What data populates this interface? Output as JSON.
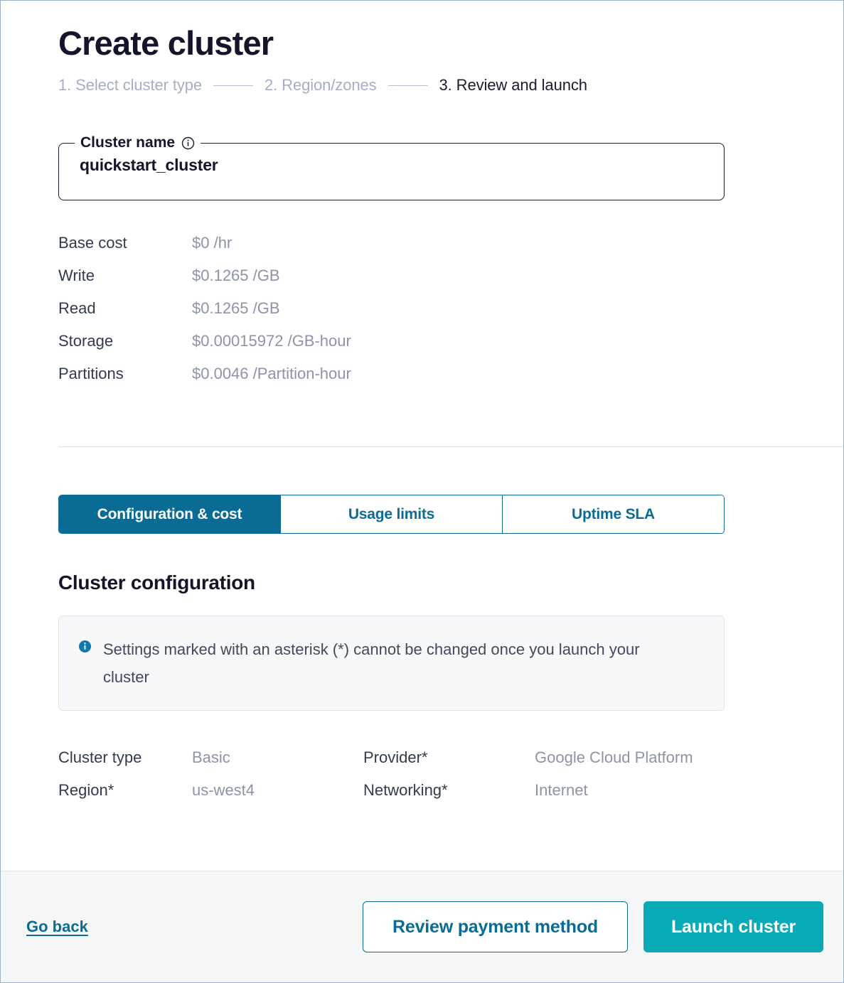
{
  "header": {
    "title": "Create cluster"
  },
  "stepper": {
    "steps": [
      {
        "label": "1. Select cluster type",
        "active": false
      },
      {
        "label": "2. Region/zones",
        "active": false
      },
      {
        "label": "3. Review and launch",
        "active": true
      }
    ]
  },
  "cluster_name_field": {
    "legend": "Cluster name",
    "info_icon": "info-outline-icon",
    "value": "quickstart_cluster"
  },
  "pricing": {
    "rows": [
      {
        "label": "Base cost",
        "value": "$0 /hr"
      },
      {
        "label": "Write",
        "value": "$0.1265 /GB"
      },
      {
        "label": "Read",
        "value": "$0.1265 /GB"
      },
      {
        "label": "Storage",
        "value": "$0.00015972 /GB-hour"
      },
      {
        "label": "Partitions",
        "value": "$0.0046 /Partition-hour"
      }
    ]
  },
  "tabs": [
    {
      "label": "Configuration & cost",
      "active": true
    },
    {
      "label": "Usage limits",
      "active": false
    },
    {
      "label": "Uptime SLA",
      "active": false
    }
  ],
  "configuration": {
    "heading": "Cluster configuration",
    "banner": {
      "icon": "info-filled-icon",
      "text": "Settings marked with an asterisk (*) cannot be changed once you launch your cluster"
    },
    "rows": [
      {
        "key_left": "Cluster type",
        "value_left": "Basic",
        "key_right": "Provider*",
        "value_right": "Google Cloud Platform"
      },
      {
        "key_left": "Region*",
        "value_left": "us-west4",
        "key_right": "Networking*",
        "value_right": "Internet"
      }
    ]
  },
  "footer": {
    "go_back_label": "Go back",
    "secondary_button_label": "Review payment method",
    "primary_button_label": "Launch cluster"
  },
  "colors": {
    "accent_blue": "#0a6c94",
    "primary_teal": "#08aab8",
    "text_dark": "#14142b",
    "text_muted": "#8e93a8",
    "banner_bg": "#f7f8fa",
    "footer_bg": "#f5f6f8"
  }
}
